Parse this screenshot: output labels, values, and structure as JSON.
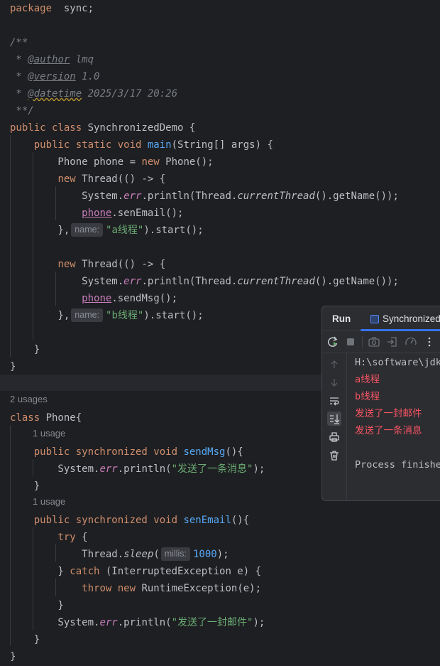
{
  "editor": {
    "lines": [
      {
        "t": [
          [
            "kw",
            "package"
          ],
          [
            "",
            "  sync;"
          ]
        ]
      },
      {
        "t": []
      },
      {
        "t": [
          [
            "cmt",
            "/**"
          ]
        ]
      },
      {
        "t": [
          [
            "cmt",
            " * "
          ],
          [
            "tag",
            "@author"
          ],
          [
            "cmt",
            " lmq"
          ]
        ]
      },
      {
        "t": [
          [
            "cmt",
            " * "
          ],
          [
            "tag",
            "@version"
          ],
          [
            "cmt",
            " 1.0"
          ]
        ]
      },
      {
        "t": [
          [
            "cmt",
            " * "
          ],
          [
            "tagw",
            "@datetime"
          ],
          [
            "cmt",
            " 2025/3/17 20:26"
          ]
        ]
      },
      {
        "t": [
          [
            "cmt",
            " **/"
          ]
        ]
      },
      {
        "t": [
          [
            "kw",
            "public class "
          ],
          [
            "",
            "SynchronizedDemo {"
          ]
        ]
      },
      {
        "t": [
          [
            "",
            "    "
          ],
          [
            "kw",
            "public static void "
          ],
          [
            "fn",
            "main"
          ],
          [
            "",
            "(String[] args) {"
          ]
        ]
      },
      {
        "t": [
          [
            "",
            "        Phone phone = "
          ],
          [
            "kw",
            "new "
          ],
          [
            "",
            "Phone();"
          ]
        ]
      },
      {
        "t": [
          [
            "",
            "        "
          ],
          [
            "kw",
            "new "
          ],
          [
            "",
            "Thread(() -> {"
          ]
        ]
      },
      {
        "t": [
          [
            "",
            "            System."
          ],
          [
            "sf",
            "err"
          ],
          [
            "",
            ".println(Thread."
          ],
          [
            "it",
            "currentThread"
          ],
          [
            "",
            "().getName());"
          ]
        ]
      },
      {
        "t": [
          [
            "",
            "            "
          ],
          [
            "fld",
            "phone"
          ],
          [
            "",
            ".senEmail();"
          ]
        ]
      },
      {
        "t": [
          [
            "",
            "        },"
          ],
          [
            "hint",
            "name:"
          ],
          [
            "str",
            "\"a线程\""
          ],
          [
            "",
            ").start();"
          ]
        ]
      },
      {
        "t": []
      },
      {
        "t": [
          [
            "",
            "        "
          ],
          [
            "kw",
            "new "
          ],
          [
            "",
            "Thread(() -> {"
          ]
        ]
      },
      {
        "t": [
          [
            "",
            "            System."
          ],
          [
            "sf",
            "err"
          ],
          [
            "",
            ".println(Thread."
          ],
          [
            "it",
            "currentThread"
          ],
          [
            "",
            "().getName());"
          ]
        ]
      },
      {
        "t": [
          [
            "",
            "            "
          ],
          [
            "fld",
            "phone"
          ],
          [
            "",
            ".sendMsg();"
          ]
        ]
      },
      {
        "t": [
          [
            "",
            "        },"
          ],
          [
            "hint",
            "name:"
          ],
          [
            "str",
            "\"b线程\""
          ],
          [
            "",
            ").start();"
          ]
        ]
      },
      {
        "t": []
      },
      {
        "t": [
          [
            "",
            "    }"
          ]
        ]
      },
      {
        "t": [
          [
            "",
            "}"
          ]
        ]
      },
      {
        "t": []
      },
      {
        "t": [
          [
            "kw",
            "class "
          ],
          [
            "",
            "Phone{"
          ]
        ]
      },
      {
        "t": [
          [
            "",
            "    "
          ],
          [
            "kw",
            "public synchronized void "
          ],
          [
            "fn",
            "sendMsg"
          ],
          [
            "",
            "(){"
          ]
        ]
      },
      {
        "t": [
          [
            "",
            "        System."
          ],
          [
            "sf",
            "err"
          ],
          [
            "",
            ".println("
          ],
          [
            "str",
            "\"发送了一条消息\""
          ],
          [
            "",
            ");"
          ]
        ]
      },
      {
        "t": [
          [
            "",
            "    }"
          ]
        ]
      },
      {
        "t": [
          [
            "",
            "    "
          ],
          [
            "kw",
            "public synchronized void "
          ],
          [
            "fn",
            "senEmail"
          ],
          [
            "",
            "(){"
          ]
        ]
      },
      {
        "t": [
          [
            "",
            "        "
          ],
          [
            "kw",
            "try "
          ],
          [
            "",
            "{"
          ]
        ]
      },
      {
        "t": [
          [
            "",
            "            Thread."
          ],
          [
            "it",
            "sleep"
          ],
          [
            "",
            "("
          ],
          [
            "hint",
            "millis:"
          ],
          [
            "fn",
            "1000"
          ],
          [
            "",
            ");"
          ]
        ]
      },
      {
        "t": [
          [
            "",
            "        } "
          ],
          [
            "kw",
            "catch "
          ],
          [
            "",
            "(InterruptedException e) {"
          ]
        ]
      },
      {
        "t": [
          [
            "",
            "            "
          ],
          [
            "kw",
            "throw new "
          ],
          [
            "",
            "RuntimeException(e);"
          ]
        ]
      },
      {
        "t": [
          [
            "",
            "        }"
          ]
        ]
      },
      {
        "t": [
          [
            "",
            "        System."
          ],
          [
            "sf",
            "err"
          ],
          [
            "",
            ".println("
          ],
          [
            "str",
            "\"发送了一封邮件\""
          ],
          [
            "",
            ");"
          ]
        ]
      },
      {
        "t": [
          [
            "",
            "    }"
          ]
        ]
      },
      {
        "t": [
          [
            "",
            "}"
          ]
        ]
      }
    ],
    "usages": {
      "phone_class": "2 usages",
      "send_msg": "1 usage",
      "sen_email": "1 usage"
    }
  },
  "run_panel": {
    "title": "Run",
    "tab_label": "SynchronizedDemo",
    "output": [
      {
        "text": "H:\\software\\jdk",
        "kind": "sys"
      },
      {
        "text": "a线程",
        "kind": "err"
      },
      {
        "text": "b线程",
        "kind": "err"
      },
      {
        "text": "发送了一封邮件",
        "kind": "err"
      },
      {
        "text": "发送了一条消息",
        "kind": "err"
      },
      {
        "text": "",
        "kind": "sys"
      },
      {
        "text": "Process finished",
        "kind": "sys"
      }
    ]
  },
  "colors": {
    "keyword": "#cf8e6d",
    "function": "#56a8f5",
    "string": "#6aab73",
    "error_output": "#f75464",
    "accent": "#3574f0"
  }
}
